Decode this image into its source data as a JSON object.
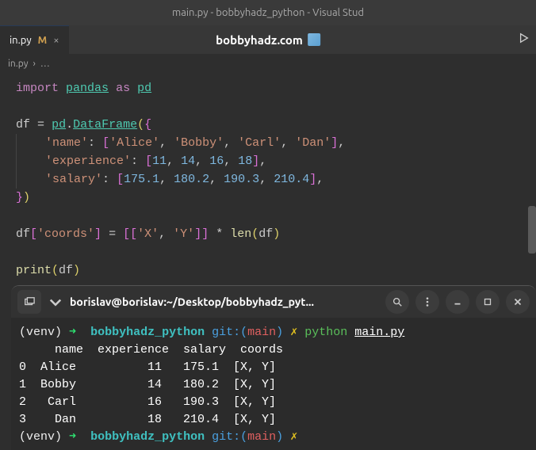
{
  "window_title": "main.py - bobbyhadz_python - Visual Stud",
  "tab": {
    "filename": "in.py",
    "modified_marker": "M"
  },
  "header_title": "bobbyhadz.com",
  "breadcrumb": {
    "file": "in.py",
    "sep": "›",
    "rest": "…"
  },
  "code": {
    "l1_import": "import",
    "l1_pandas": "pandas",
    "l1_as": "as",
    "l1_pd": "pd",
    "l3_df": "df",
    "l3_eq": "=",
    "l3_pd": "pd",
    "l3_dot": ".",
    "l3_dataframe": "DataFrame",
    "l4_name": "'name'",
    "l4_v1": "'Alice'",
    "l4_v2": "'Bobby'",
    "l4_v3": "'Carl'",
    "l4_v4": "'Dan'",
    "l5_exp": "'experience'",
    "l5_v1": "11",
    "l5_v2": "14",
    "l5_v3": "16",
    "l5_v4": "18",
    "l6_sal": "'salary'",
    "l6_v1": "175.1",
    "l6_v2": "180.2",
    "l6_v3": "190.3",
    "l6_v4": "210.4",
    "l9_df": "df",
    "l9_coords": "'coords'",
    "l9_eq": "=",
    "l9_x": "'X'",
    "l9_y": "'Y'",
    "l9_star": "*",
    "l9_len": "len",
    "l9_df2": "df",
    "l11_print": "print",
    "l11_df": "df"
  },
  "terminal": {
    "title": "borislav@borislav:~/Desktop/bobbyhadz_pyt...",
    "venv": "(venv)",
    "arrow": "➜",
    "dir": "bobbyhadz_python",
    "git": "git:",
    "branch": "main",
    "dirty": "✗",
    "cmd": "python",
    "arg": "main.py",
    "out_header": "     name  experience  salary  coords",
    "out_r0": "0  Alice          11   175.1  [X, Y]",
    "out_r1": "1  Bobby          14   180.2  [X, Y]",
    "out_r2": "2   Carl          16   190.3  [X, Y]",
    "out_r3": "3    Dan          18   210.4  [X, Y]"
  }
}
